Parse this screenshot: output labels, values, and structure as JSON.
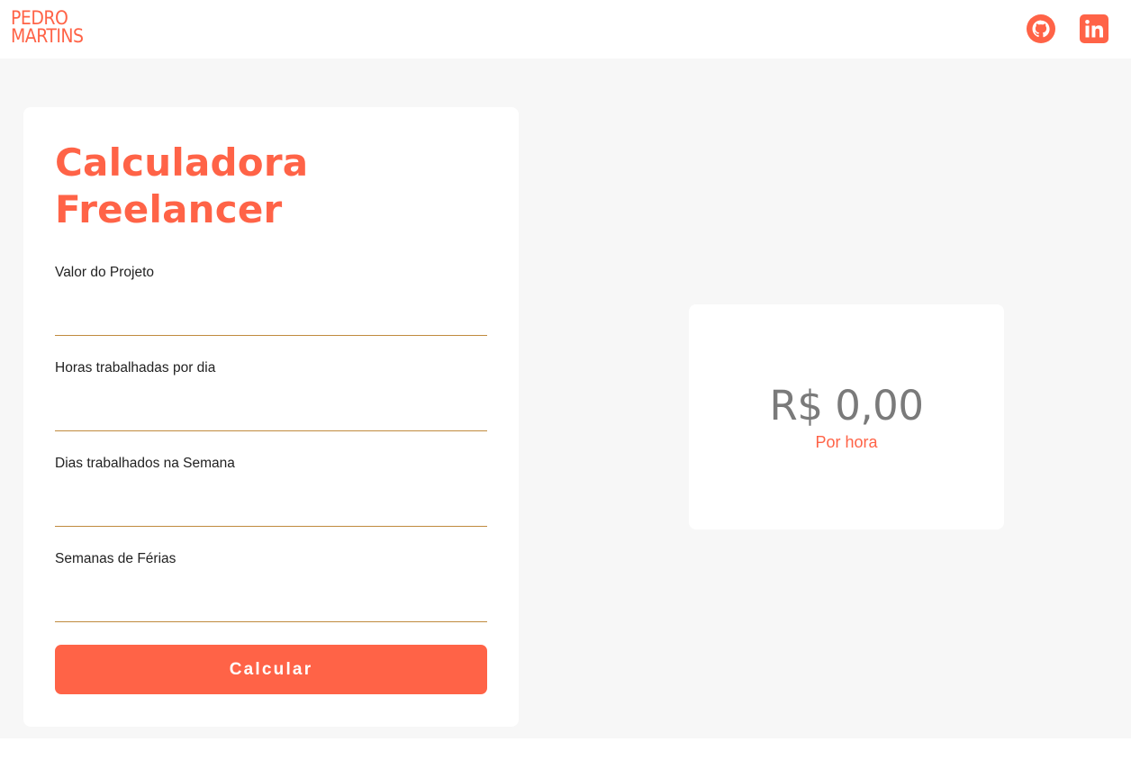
{
  "header": {
    "logo_line1": "PEDRO",
    "logo_line2": "MARTINS",
    "links": [
      {
        "icon": "github-icon"
      },
      {
        "icon": "linkedin-icon"
      }
    ]
  },
  "form": {
    "title": "Calculadora Freelancer",
    "fields": [
      {
        "label": "Valor do Projeto",
        "value": "",
        "placeholder": ""
      },
      {
        "label": "Horas trabalhadas por dia",
        "value": "",
        "placeholder": ""
      },
      {
        "label": "Dias trabalhados na Semana",
        "value": "",
        "placeholder": ""
      },
      {
        "label": "Semanas de Férias",
        "value": "",
        "placeholder": ""
      }
    ],
    "button_label": "Calcular"
  },
  "result": {
    "value": "R$ 0,00",
    "unit": "Por hora"
  },
  "colors": {
    "accent": "#ff6347",
    "background": "#f7f7f7",
    "input_underline": "#c08a3e",
    "result_text": "#7a7a7a"
  }
}
